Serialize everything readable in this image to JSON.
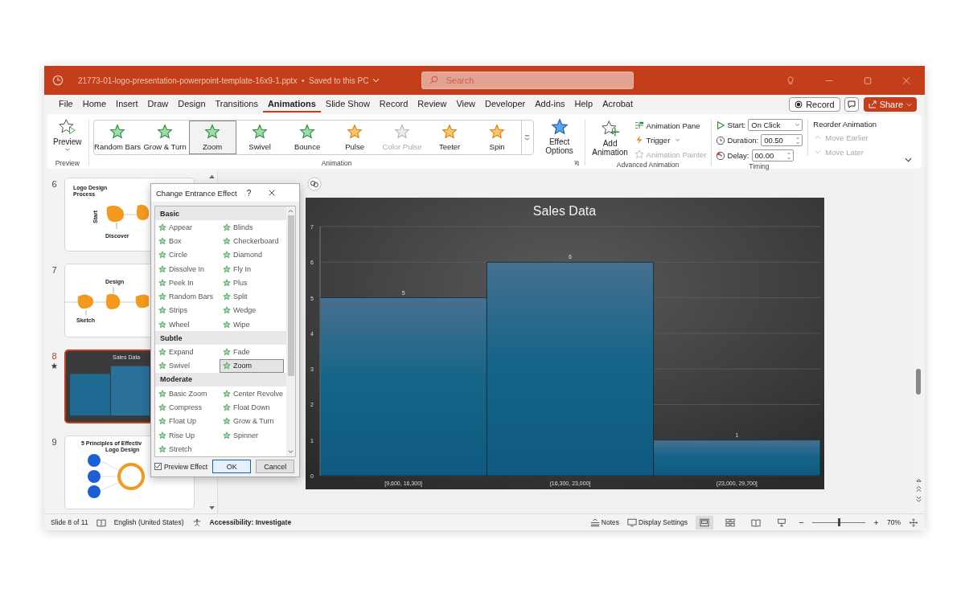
{
  "window": {
    "title": "21773-01-logo-presentation-powerpoint-template-16x9-1.pptx  •  Saved to this PC"
  },
  "search": {
    "placeholder": "Search"
  },
  "menu_tabs": [
    {
      "label": "File",
      "selected": false
    },
    {
      "label": "Home",
      "selected": false
    },
    {
      "label": "Insert",
      "selected": false
    },
    {
      "label": "Draw",
      "selected": false
    },
    {
      "label": "Design",
      "selected": false
    },
    {
      "label": "Transitions",
      "selected": false
    },
    {
      "label": "Animations",
      "selected": true
    },
    {
      "label": "Slide Show",
      "selected": false
    },
    {
      "label": "Record",
      "selected": false
    },
    {
      "label": "Review",
      "selected": false
    },
    {
      "label": "View",
      "selected": false
    },
    {
      "label": "Developer",
      "selected": false
    },
    {
      "label": "Add-ins",
      "selected": false
    },
    {
      "label": "Help",
      "selected": false
    },
    {
      "label": "Acrobat",
      "selected": false
    }
  ],
  "record_button": "Record",
  "share_button": "Share",
  "ribbon": {
    "preview": {
      "label": "Preview",
      "group": "Preview"
    },
    "gallery": [
      {
        "label": "Random Bars",
        "kind": "entrance",
        "selected": false,
        "disabled": false
      },
      {
        "label": "Grow & Turn",
        "kind": "entrance",
        "selected": false,
        "disabled": false
      },
      {
        "label": "Zoom",
        "kind": "entrance",
        "selected": true,
        "disabled": false
      },
      {
        "label": "Swivel",
        "kind": "entrance",
        "selected": false,
        "disabled": false
      },
      {
        "label": "Bounce",
        "kind": "entrance",
        "selected": false,
        "disabled": false
      },
      {
        "label": "Pulse",
        "kind": "emphasis",
        "selected": false,
        "disabled": false
      },
      {
        "label": "Color Pulse",
        "kind": "emphasis",
        "selected": false,
        "disabled": true
      },
      {
        "label": "Teeter",
        "kind": "emphasis",
        "selected": false,
        "disabled": false
      },
      {
        "label": "Spin",
        "kind": "emphasis",
        "selected": false,
        "disabled": false
      }
    ],
    "effect_options": "Effect Options",
    "animation_group": "Animation",
    "add_animation": "Add Animation",
    "advanced_items": [
      {
        "label": "Animation Pane",
        "kind": "pane",
        "disabled": false
      },
      {
        "label": "Trigger",
        "kind": "trigger",
        "disabled": false
      },
      {
        "label": "Animation Painter",
        "kind": "painter",
        "disabled": true
      }
    ],
    "advanced_group": "Advanced Animation",
    "timing": {
      "start_label": "Start:",
      "start_value": "On Click",
      "duration_label": "Duration:",
      "duration_value": "00.50",
      "delay_label": "Delay:",
      "delay_value": "00.00",
      "group": "Timing"
    },
    "reorder": {
      "title": "Reorder Animation",
      "items": [
        {
          "label": "Move Earlier",
          "kind": "up",
          "disabled": true
        },
        {
          "label": "Move Later",
          "kind": "down",
          "disabled": true
        }
      ]
    }
  },
  "slides": [
    {
      "number": "6",
      "selected": false,
      "has_animation": false,
      "kind": "process",
      "texts": [
        "Logo Design Process",
        "Start",
        "Discover"
      ]
    },
    {
      "number": "7",
      "selected": false,
      "has_animation": false,
      "kind": "timeline",
      "texts": [
        "Design",
        "Sketch"
      ]
    },
    {
      "number": "8",
      "selected": true,
      "has_animation": true,
      "kind": "chart",
      "texts": [
        "Sales Data"
      ]
    },
    {
      "number": "9",
      "selected": false,
      "has_animation": false,
      "kind": "circles",
      "texts": [
        "5 Principles of Effectiv",
        "Logo Design"
      ]
    }
  ],
  "dialog": {
    "title": "Change Entrance Effect",
    "help": "?",
    "sections": [
      {
        "name": "Basic",
        "effects": [
          {
            "label": "Appear",
            "selected": false
          },
          {
            "label": "Blinds",
            "selected": false
          },
          {
            "label": "Box",
            "selected": false
          },
          {
            "label": "Checkerboard",
            "selected": false
          },
          {
            "label": "Circle",
            "selected": false
          },
          {
            "label": "Diamond",
            "selected": false
          },
          {
            "label": "Dissolve In",
            "selected": false
          },
          {
            "label": "Fly In",
            "selected": false
          },
          {
            "label": "Peek In",
            "selected": false
          },
          {
            "label": "Plus",
            "selected": false
          },
          {
            "label": "Random Bars",
            "selected": false
          },
          {
            "label": "Split",
            "selected": false
          },
          {
            "label": "Strips",
            "selected": false
          },
          {
            "label": "Wedge",
            "selected": false
          },
          {
            "label": "Wheel",
            "selected": false
          },
          {
            "label": "Wipe",
            "selected": false
          }
        ]
      },
      {
        "name": "Subtle",
        "effects": [
          {
            "label": "Expand",
            "selected": false
          },
          {
            "label": "Fade",
            "selected": false
          },
          {
            "label": "Swivel",
            "selected": false
          },
          {
            "label": "Zoom",
            "selected": true
          }
        ]
      },
      {
        "name": "Moderate",
        "effects": [
          {
            "label": "Basic Zoom",
            "selected": false
          },
          {
            "label": "Center Revolve",
            "selected": false
          },
          {
            "label": "Compress",
            "selected": false
          },
          {
            "label": "Float Down",
            "selected": false
          },
          {
            "label": "Float Up",
            "selected": false
          },
          {
            "label": "Grow & Turn",
            "selected": false
          },
          {
            "label": "Rise Up",
            "selected": false
          },
          {
            "label": "Spinner",
            "selected": false
          },
          {
            "label": "Stretch",
            "selected": false
          }
        ]
      }
    ],
    "preview_effect": {
      "label": "Preview Effect",
      "checked": true
    },
    "ok": "OK",
    "cancel": "Cancel"
  },
  "slide_chart": {
    "chart_data": {
      "type": "bar",
      "title": "Sales Data",
      "categories": [
        "[9,600, 16,300]",
        "(16,300, 23,000]",
        "(23,000, 29,700]"
      ],
      "values": [
        5,
        6,
        1
      ],
      "ylim": [
        0,
        7
      ],
      "yticks": [
        0,
        1,
        2,
        3,
        4,
        5,
        6,
        7
      ],
      "data_labels": true,
      "grid": true
    }
  },
  "status_bar": {
    "slide_info": "Slide 8 of 11",
    "language": "English (United States)",
    "accessibility": "Accessibility: Investigate",
    "notes": "Notes",
    "display_settings": "Display Settings",
    "views": [
      {
        "kind": "normal",
        "selected": true
      },
      {
        "kind": "sorter",
        "selected": false
      },
      {
        "kind": "reading",
        "selected": false
      },
      {
        "kind": "slideshow",
        "selected": false
      }
    ],
    "zoom": {
      "level": 0.5,
      "reading": "70%"
    }
  }
}
